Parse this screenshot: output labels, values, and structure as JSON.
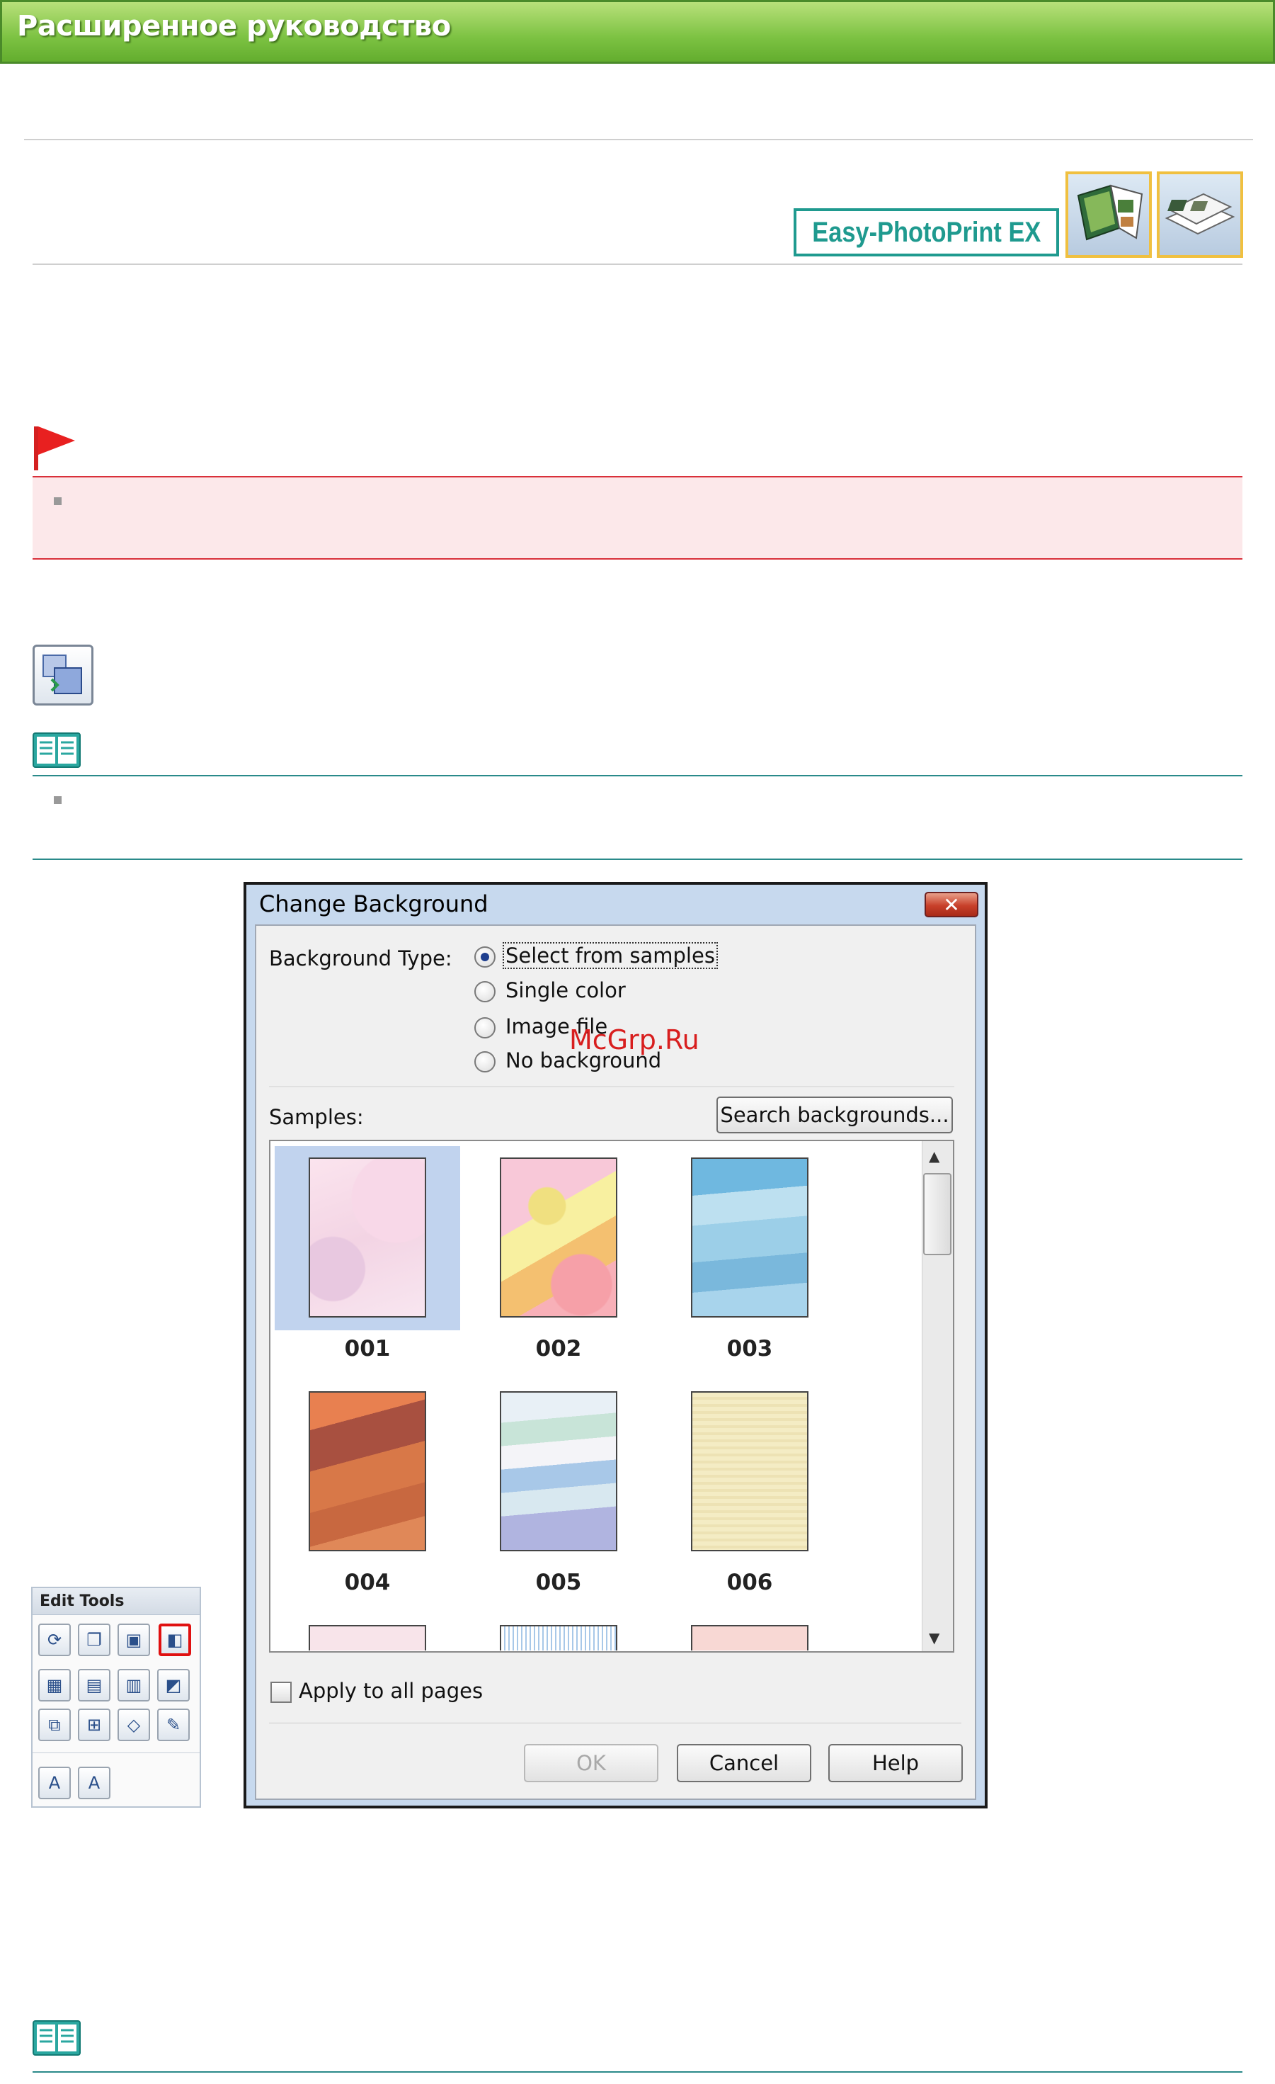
{
  "header": {
    "title": "Расширенное руководство"
  },
  "product": {
    "badge_label": "Easy-PhotoPrint EX",
    "icons": [
      "album-icon",
      "layout-print-icon"
    ]
  },
  "important": {
    "icon": "red-flag-icon"
  },
  "note": {
    "icon": "note-book-icon"
  },
  "dialog": {
    "title": "Change Background",
    "background_type_label": "Background Type:",
    "options": [
      "Select from samples",
      "Single color",
      "Image file",
      "No background"
    ],
    "selected_option": "Select from samples",
    "samples_label": "Samples:",
    "search_button": "Search backgrounds...",
    "samples": [
      "001",
      "002",
      "003",
      "004",
      "005",
      "006"
    ],
    "selected_sample": "001",
    "apply_all_label": "Apply to all pages",
    "ok_button": "OK",
    "cancel_button": "Cancel",
    "help_button": "Help"
  },
  "edit_tools": {
    "title": "Edit Tools"
  },
  "watermark": "McGrp.Ru",
  "colors": {
    "banner_green": "#7cc242",
    "badge_teal": "#1f9a8f",
    "important_red": "#d9303a",
    "note_teal": "#2a8a8a",
    "selection_blue": "#c1d3ee"
  }
}
